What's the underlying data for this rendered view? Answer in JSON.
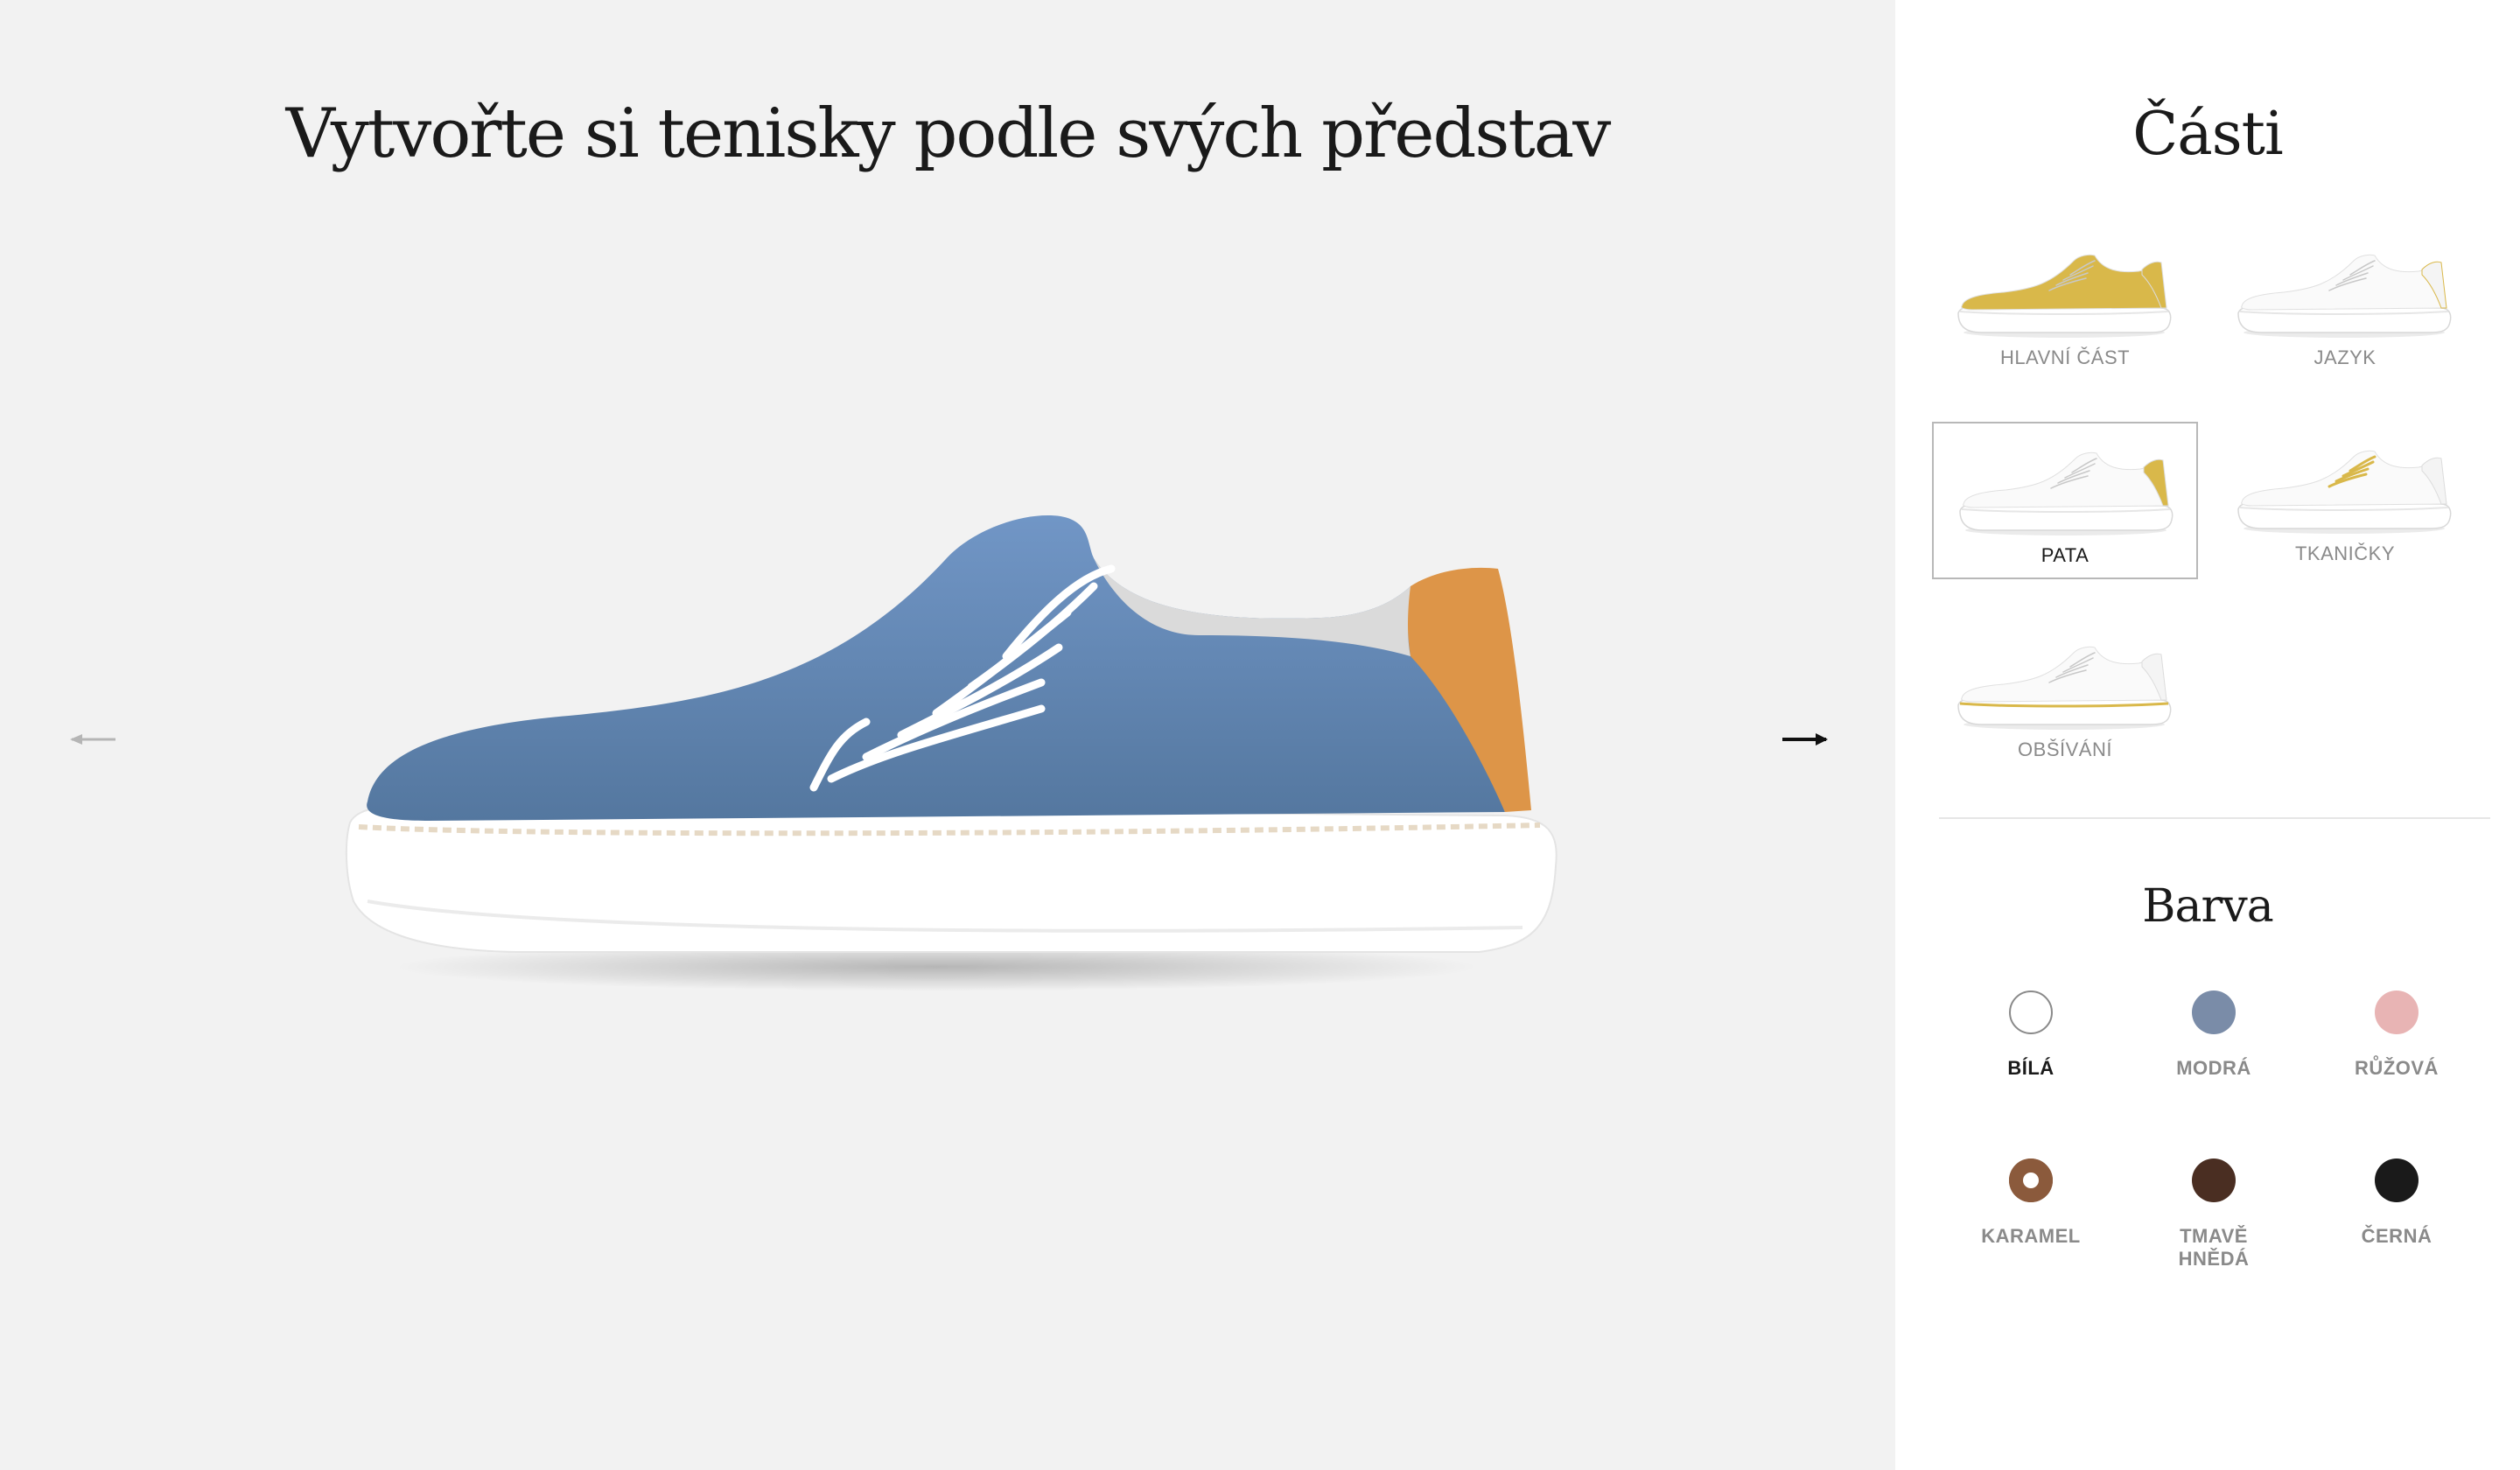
{
  "headline": "Vytvořte si tenisky podle svých představ",
  "nav": {
    "prev_icon": "arrow-left-icon",
    "next_icon": "arrow-right-icon"
  },
  "preview": {
    "colors": {
      "upper": "#6487b7",
      "heel": "#dd9548",
      "laces": "#ffffff",
      "sole": "#ffffff"
    }
  },
  "parts_panel": {
    "title": "Části",
    "items": [
      {
        "label": "HLAVNÍ ČÁST",
        "highlight": "upper",
        "selected": false
      },
      {
        "label": "JAZYK",
        "highlight": "tongue",
        "selected": false
      },
      {
        "label": "PATA",
        "highlight": "heel",
        "selected": true
      },
      {
        "label": "TKANIČKY",
        "highlight": "laces",
        "selected": false
      },
      {
        "label": "OBŠÍVÁNÍ",
        "highlight": "stitching",
        "selected": false
      }
    ],
    "highlight_color": "#d9b84a"
  },
  "color_panel": {
    "title": "Barva",
    "swatches": [
      {
        "label": "BÍLÁ",
        "hex": "#ffffff",
        "active": true,
        "ring": false
      },
      {
        "label": "MODRÁ",
        "hex": "#7a8ca8",
        "active": false,
        "ring": false
      },
      {
        "label": "RŮŽOVÁ",
        "hex": "#e8b4b4",
        "active": false,
        "ring": false
      },
      {
        "label": "KARAMEL",
        "hex": "#8b5a3c",
        "active": false,
        "ring": true
      },
      {
        "label": "TMAVĚ HNĚDÁ",
        "hex": "#4a2e22",
        "active": false,
        "ring": false
      },
      {
        "label": "ČERNÁ",
        "hex": "#1a1a1a",
        "active": false,
        "ring": false
      }
    ]
  }
}
